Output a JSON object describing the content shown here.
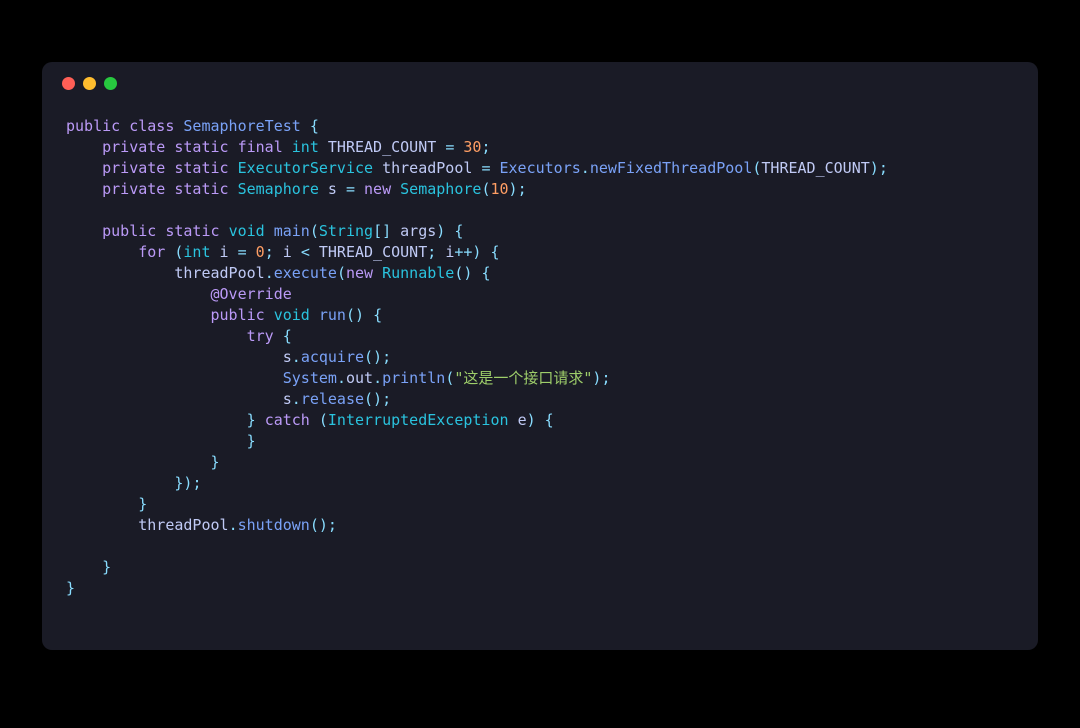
{
  "window": {
    "buttons": [
      "close",
      "minimize",
      "maximize"
    ]
  },
  "code": {
    "class_name": "SemaphoreTest",
    "thread_count_field": "THREAD_COUNT",
    "thread_count_value": "30",
    "executor_type": "ExecutorService",
    "pool_var": "threadPool",
    "executors_call": "Executors",
    "executors_method": "newFixedThreadPool",
    "semaphore_type": "Semaphore",
    "semaphore_var": "s",
    "semaphore_arg": "10",
    "main_args_type": "String",
    "main_args_name": "args",
    "loop_var": "i",
    "loop_init": "0",
    "override_annotation": "@Override",
    "run_method": "run",
    "acquire_method": "acquire",
    "println_obj1": "System",
    "println_obj2": "out",
    "println_method": "println",
    "println_string": "\"这是一个接口请求\"",
    "release_method": "release",
    "exception_type": "InterruptedException",
    "exception_var": "e",
    "shutdown_method": "shutdown",
    "kw_public": "public",
    "kw_class": "class",
    "kw_private": "private",
    "kw_static": "static",
    "kw_final": "final",
    "kw_int": "int",
    "kw_new": "new",
    "kw_void": "void",
    "kw_for": "for",
    "kw_try": "try",
    "kw_catch": "catch",
    "method_main": "main",
    "method_execute": "execute",
    "type_runnable": "Runnable"
  }
}
